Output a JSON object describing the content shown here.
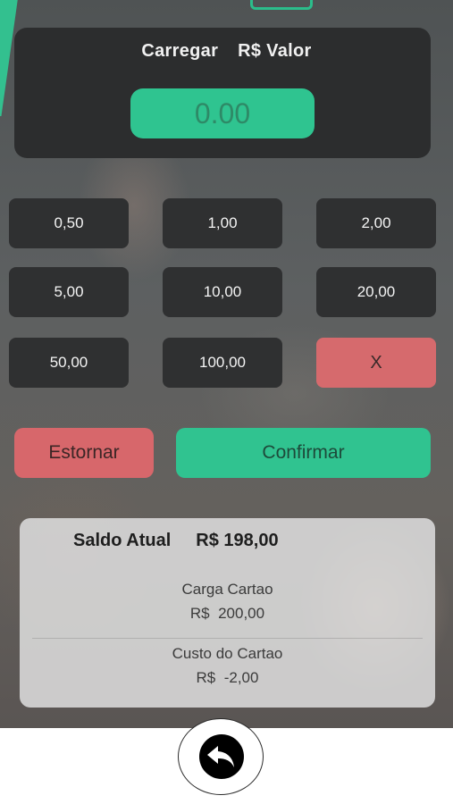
{
  "header": {
    "load_label": "Carregar",
    "value_label": "R$ Valor",
    "amount_display": "0.00"
  },
  "amounts": [
    "0,50",
    "1,00",
    "2,00",
    "5,00",
    "10,00",
    "20,00",
    "50,00",
    "100,00"
  ],
  "clear_label": "X",
  "actions": {
    "refund_label": "Estornar",
    "confirm_label": "Confirmar"
  },
  "summary": {
    "balance_label": "Saldo Atual",
    "balance_value": "R$ 198,00",
    "card_load_label": "Carga Cartao",
    "card_load_value": "R$  200,00",
    "card_cost_label": "Custo do Cartao",
    "card_cost_value": "R$  -2,00"
  },
  "colors": {
    "accent": "#30c390",
    "danger": "#d7676b",
    "panel": "#2c2d2e"
  },
  "icons": {
    "back": "undo-arrow-icon"
  }
}
